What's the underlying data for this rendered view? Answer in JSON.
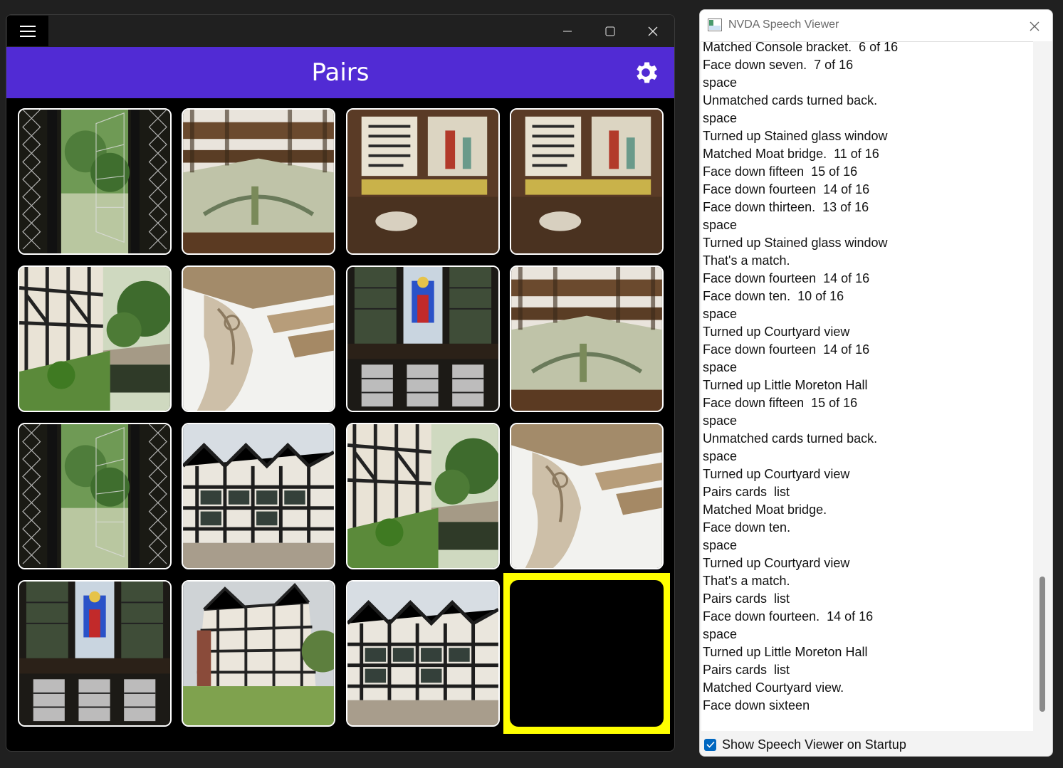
{
  "pairs_app": {
    "title": "Pairs",
    "window_controls": [
      "minimize-icon",
      "maximize-icon",
      "close-icon"
    ],
    "accent_color": "#512bd4",
    "focus_color": "#ffff00",
    "cards": [
      {
        "row": 1,
        "col": 1,
        "state": "face-up",
        "image": "open leaded window garden view"
      },
      {
        "row": 1,
        "col": 2,
        "state": "face-up",
        "image": "painted plaster gable under beams"
      },
      {
        "row": 1,
        "col": 3,
        "state": "face-up",
        "image": "painted wall panels with text"
      },
      {
        "row": 1,
        "col": 4,
        "state": "face-up",
        "image": "painted wall panels with text"
      },
      {
        "row": 2,
        "col": 1,
        "state": "face-up",
        "image": "moat bridge by timbered wall"
      },
      {
        "row": 2,
        "col": 2,
        "state": "face-up",
        "image": "carved console bracket"
      },
      {
        "row": 2,
        "col": 3,
        "state": "face-up",
        "image": "stained glass window"
      },
      {
        "row": 2,
        "col": 4,
        "state": "face-up",
        "image": "painted plaster gable under beams"
      },
      {
        "row": 3,
        "col": 1,
        "state": "face-up",
        "image": "open leaded window garden view"
      },
      {
        "row": 3,
        "col": 2,
        "state": "face-up",
        "image": "courtyard view of timbered hall"
      },
      {
        "row": 3,
        "col": 3,
        "state": "face-up",
        "image": "moat bridge by timbered wall"
      },
      {
        "row": 3,
        "col": 4,
        "state": "face-up",
        "image": "carved console bracket"
      },
      {
        "row": 4,
        "col": 1,
        "state": "face-up",
        "image": "stained glass window"
      },
      {
        "row": 4,
        "col": 2,
        "state": "face-up",
        "image": "Little Moreton Hall exterior"
      },
      {
        "row": 4,
        "col": 3,
        "state": "face-up",
        "image": "courtyard view of timbered hall"
      },
      {
        "row": 4,
        "col": 4,
        "state": "face-down",
        "focused": true
      }
    ]
  },
  "nvda": {
    "title": "NVDA Speech Viewer",
    "close_icon": "close-icon",
    "lines": [
      "Matched Console bracket.  6 of 16",
      "Face down seven.  7 of 16",
      "space",
      "Unmatched cards turned back.",
      "space",
      "Turned up Stained glass window",
      "Matched Moat bridge.  11 of 16",
      "Face down fifteen  15 of 16",
      "Face down fourteen  14 of 16",
      "Face down thirteen.  13 of 16",
      "space",
      "Turned up Stained glass window",
      "That's a match.",
      "Face down fourteen  14 of 16",
      "Face down ten.  10 of 16",
      "space",
      "Turned up Courtyard view",
      "Face down fourteen  14 of 16",
      "space",
      "Turned up Little Moreton Hall",
      "Face down fifteen  15 of 16",
      "space",
      "Unmatched cards turned back.",
      "space",
      "Turned up Courtyard view",
      "Pairs cards  list",
      "Matched Moat bridge.",
      "Face down ten.",
      "space",
      "Turned up Courtyard view",
      "That's a match.",
      "Pairs cards  list",
      "Face down fourteen.  14 of 16",
      "space",
      "Turned up Little Moreton Hall",
      "Pairs cards  list",
      "Matched Courtyard view.",
      "Face down sixteen"
    ],
    "startup_checkbox": {
      "label": "Show Speech Viewer on Startup",
      "checked": true
    }
  }
}
